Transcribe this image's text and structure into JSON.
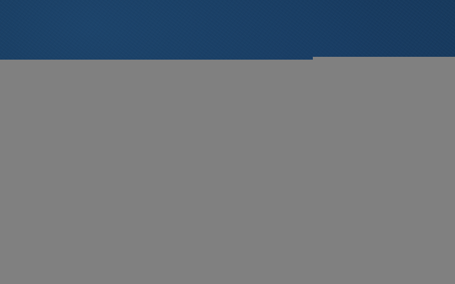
{
  "desktop": {
    "wallpaper_color": "#16385a"
  },
  "windows": [
    {
      "id": "back-window",
      "fill_color": "#808080",
      "content_loaded": false
    },
    {
      "id": "main-window",
      "fill_color": "#808080",
      "content_loaded": false
    }
  ]
}
